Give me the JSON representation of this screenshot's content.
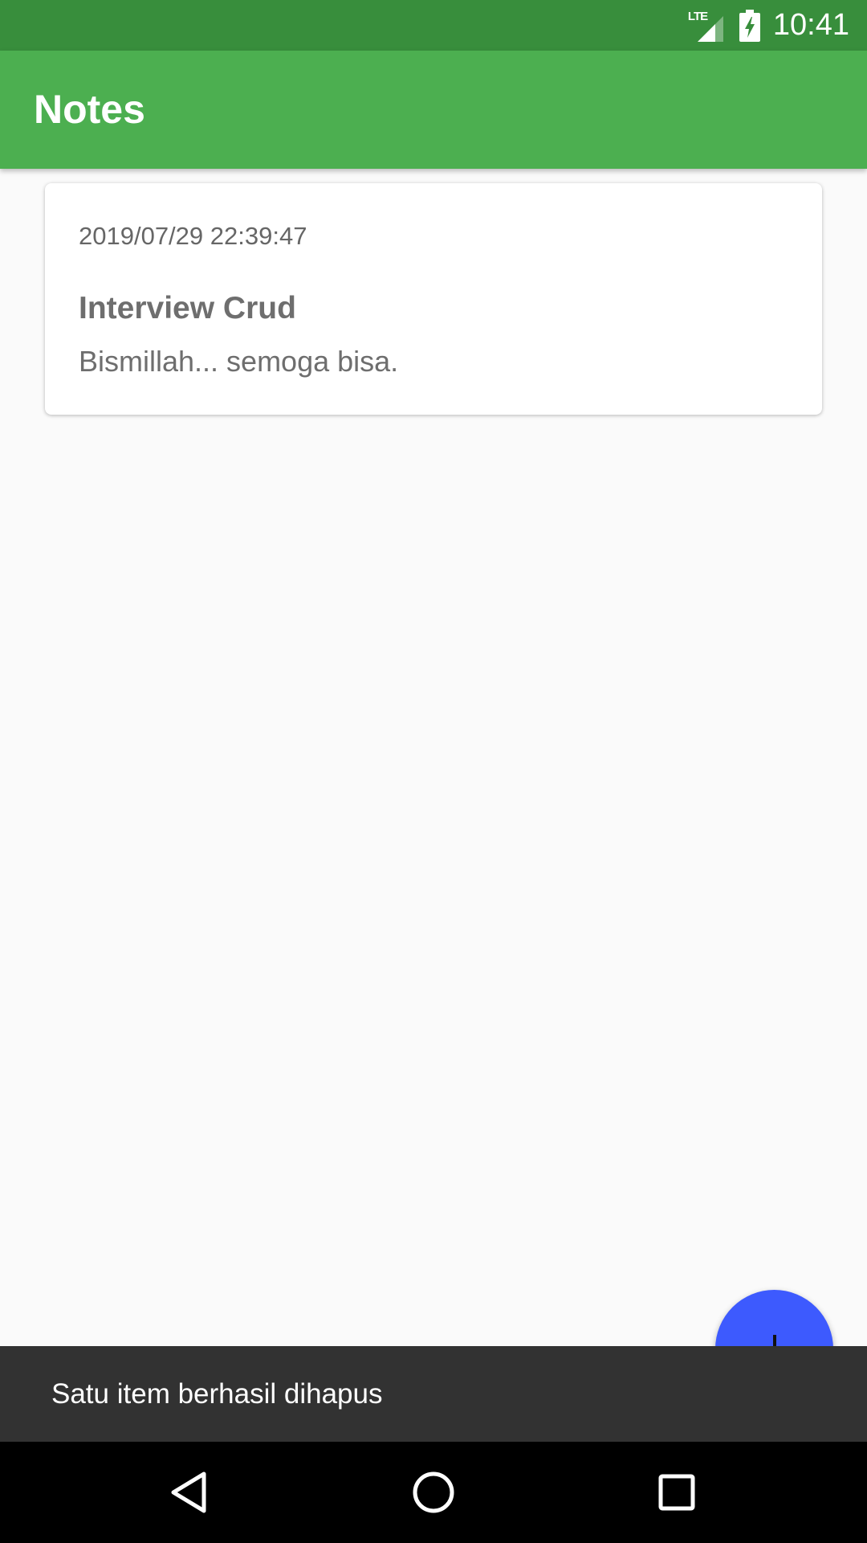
{
  "status_bar": {
    "network_label": "LTE",
    "time": "10:41",
    "icons": [
      "lte-signal-icon",
      "battery-charging-icon"
    ]
  },
  "app_bar": {
    "title": "Notes"
  },
  "notes": [
    {
      "date": "2019/07/29 22:39:47",
      "title": "Interview Crud",
      "body": "Bismillah... semoga bisa."
    }
  ],
  "fab": {
    "icon": "plus-icon",
    "color": "#3d5afe"
  },
  "snackbar": {
    "message": "Satu item berhasil dihapus"
  },
  "nav_bar": {
    "icons": [
      "back-icon",
      "home-icon",
      "recents-icon"
    ]
  },
  "colors": {
    "status_bar": "#388e3c",
    "app_bar": "#4caf50",
    "snackbar": "#323232",
    "background": "#fafafa"
  }
}
